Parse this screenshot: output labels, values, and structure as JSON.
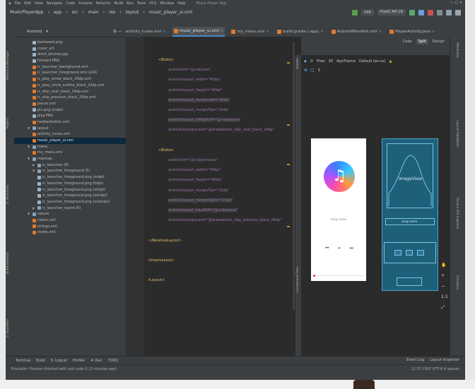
{
  "menubar": {
    "items": [
      "File",
      "Edit",
      "View",
      "Navigate",
      "Code",
      "Analyze",
      "Refactor",
      "Build",
      "Run",
      "Tools",
      "VCS",
      "Window",
      "Help"
    ],
    "title": "Music Player App"
  },
  "navbar": {
    "crumbs": [
      "MusicPlayerApp",
      "app",
      "src",
      "main",
      "res",
      "layout",
      "music_player_ui.xml"
    ],
    "run_config": "app",
    "device": "Pixel2 API 28"
  },
  "tabs": [
    {
      "label": "activity_tunes.xml",
      "active": false
    },
    {
      "label": "music_player_ui.xml",
      "active": true
    },
    {
      "label": "my_menu.xml",
      "active": false
    },
    {
      "label": "build.gradle (:app)",
      "active": false
    },
    {
      "label": "AndroidManifest.xml",
      "active": false
    },
    {
      "label": "PlayerActivity.java",
      "active": false
    }
  ],
  "project": {
    "view_selector": "Android",
    "tree": [
      {
        "label": "backward.png",
        "indent": 2,
        "icon": "png"
      },
      {
        "label": "cover_art",
        "indent": 2,
        "icon": "png"
      },
      {
        "label": "droid_phones.jpg",
        "indent": 2,
        "icon": "png"
      },
      {
        "label": "forward.PNG",
        "indent": 2,
        "icon": "png"
      },
      {
        "label": "ic_launcher_background.xml",
        "indent": 2,
        "icon": "xml"
      },
      {
        "label": "ic_launcher_foreground.xml (v24)",
        "indent": 2,
        "icon": "xml"
      },
      {
        "label": "ic_play_arrow_black_24dp.xml",
        "indent": 2,
        "icon": "xml"
      },
      {
        "label": "ic_play_circle_outline_black_24dp.xml",
        "indent": 2,
        "icon": "xml"
      },
      {
        "label": "ic_skip_next_black_24dp.xml",
        "indent": 2,
        "icon": "xml"
      },
      {
        "label": "ic_skip_previous_black_24dp.xml",
        "indent": 2,
        "icon": "xml"
      },
      {
        "label": "pause.xml",
        "indent": 2,
        "icon": "xml"
      },
      {
        "label": "pic.png (mdpi)",
        "indent": 2,
        "icon": "png"
      },
      {
        "label": "play.PNG",
        "indent": 2,
        "icon": "png"
      },
      {
        "label": "toolbarbutton.xml",
        "indent": 2,
        "icon": "xml"
      },
      {
        "label": "layout",
        "indent": 1,
        "icon": "folder",
        "open": true
      },
      {
        "label": "activity_tunes.xml",
        "indent": 2,
        "icon": "xml"
      },
      {
        "label": "music_player_ui.xml",
        "indent": 2,
        "icon": "xml",
        "selected": true
      },
      {
        "label": "menu",
        "indent": 1,
        "icon": "folder",
        "open": true
      },
      {
        "label": "my_menu.xml",
        "indent": 2,
        "icon": "xml"
      },
      {
        "label": "mipmap",
        "indent": 1,
        "icon": "folder",
        "open": true
      },
      {
        "label": "ic_launcher (6)",
        "indent": 2,
        "icon": "folder",
        "open": false
      },
      {
        "label": "ic_launcher_foreground (5)",
        "indent": 2,
        "icon": "folder",
        "open": true
      },
      {
        "label": "ic_launcher_foreground.png (mdpi)",
        "indent": 3,
        "icon": "png"
      },
      {
        "label": "ic_launcher_foreground.png (hdpi)",
        "indent": 3,
        "icon": "png"
      },
      {
        "label": "ic_launcher_foreground.png (xhdpi)",
        "indent": 3,
        "icon": "png"
      },
      {
        "label": "ic_launcher_foreground.png (xxhdpi)",
        "indent": 3,
        "icon": "png"
      },
      {
        "label": "ic_launcher_foreground.png (xxxhdpi)",
        "indent": 3,
        "icon": "png"
      },
      {
        "label": "ic_launcher_round (6)",
        "indent": 2,
        "icon": "folder",
        "open": false
      },
      {
        "label": "values",
        "indent": 1,
        "icon": "folder",
        "open": true
      },
      {
        "label": "colors.xml",
        "indent": 2,
        "icon": "xml"
      },
      {
        "label": "strings.xml",
        "indent": 2,
        "icon": "xml"
      },
      {
        "label": "styles.xml",
        "indent": 2,
        "icon": "xml"
      }
    ]
  },
  "code_lines": [
    {
      "text": "<Button",
      "kind": "tag",
      "indent": 1
    },
    {
      "text": "android:id=\"@+id/next\"",
      "kind": "attr",
      "indent": 2
    },
    {
      "text": "android:layout_width=\"40dp\"",
      "kind": "attr",
      "indent": 2
    },
    {
      "text": "android:layout_height=\"40dp\"",
      "kind": "attr",
      "indent": 2
    },
    {
      "text": "android:layout_marginLeft=\"20dp\"",
      "kind": "attr",
      "indent": 2,
      "hl": true
    },
    {
      "text": "android:layout_marginTop=\"15dp\"",
      "kind": "attr",
      "indent": 2
    },
    {
      "text": "android:layout_toRightOf=\"@+id/pause\"",
      "kind": "attr",
      "indent": 2,
      "hl": true
    },
    {
      "text": "android:background=\"@drawable/ic_skip_next_black_24dp\"",
      "kind": "attr",
      "indent": 2
    },
    {
      "text": "",
      "kind": "blank",
      "indent": 0
    },
    {
      "text": "<Button",
      "kind": "tag",
      "indent": 1
    },
    {
      "text": "android:id=\"@+id/previous\"",
      "kind": "attr",
      "indent": 2
    },
    {
      "text": "android:layout_width=\"40dp\"",
      "kind": "attr",
      "indent": 2
    },
    {
      "text": "android:layout_height=\"40dp\"",
      "kind": "attr",
      "indent": 2
    },
    {
      "text": "android:layout_marginTop=\"15dp\"",
      "kind": "attr",
      "indent": 2
    },
    {
      "text": "android:layout_marginRight=\"20dp\"",
      "kind": "attr",
      "indent": 2,
      "hl": true
    },
    {
      "text": "android:layout_toLeftOf=\"@+id/pause\"",
      "kind": "attr",
      "indent": 2,
      "hl": true
    },
    {
      "text": "android:background=\"@drawable/ic_skip_previous_black_24dp\"",
      "kind": "attr",
      "indent": 2
    },
    {
      "text": "",
      "kind": "blank",
      "indent": 0
    },
    {
      "text": "</RelativeLayout>",
      "kind": "tag",
      "indent": 0
    },
    {
      "text": "",
      "kind": "blank",
      "indent": 0
    },
    {
      "text": "LinearLayout>",
      "kind": "tag",
      "indent": 0
    },
    {
      "text": "",
      "kind": "blank",
      "indent": 0
    },
    {
      "text": "rLayout>",
      "kind": "tag",
      "indent": 0
    }
  ],
  "design": {
    "modes": [
      "Code",
      "Split",
      "Design"
    ],
    "active_mode": "Split",
    "device": "Pixel",
    "api": "30",
    "theme": "AppTheme",
    "locale": "Default (en-us)",
    "song_label": "song name",
    "blueprint_imageview": "ImageView",
    "blueprint_song": "song name"
  },
  "sidebars": {
    "left": [
      "Resource Manager",
      "Project",
      "Z: Structure",
      "Build Variants",
      "2: Favorites"
    ],
    "palette": [
      "Palette",
      "Component Tree"
    ],
    "right": [
      "Attributes",
      "Layout Validation",
      "Device File Explorer",
      "Emulator"
    ]
  },
  "bottom_tools": [
    "Terminal",
    "Build",
    "6: Logcat",
    "Profiler",
    "4: Run",
    "TODO"
  ],
  "bottom_tools_right": [
    "Event Log",
    "Layout Inspector"
  ],
  "status": {
    "message": "Emulator: Process finished with exit code 0 (2 minutes ago)",
    "position": "11:37  CRLF  UTF-8  4 spaces"
  }
}
